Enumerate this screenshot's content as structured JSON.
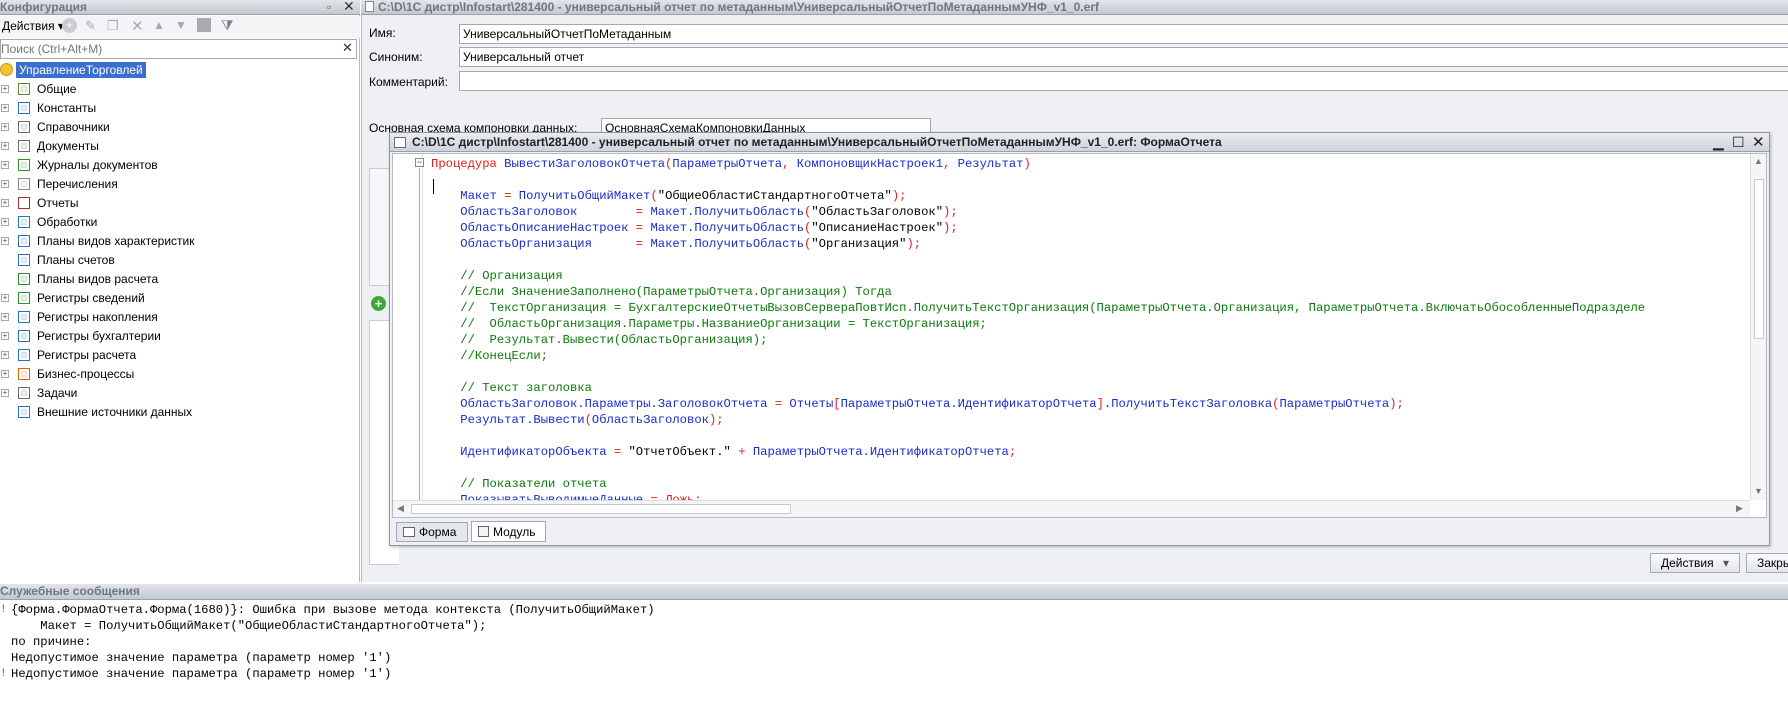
{
  "config_panel": {
    "title": "Конфигурация",
    "actions_label": "Действия",
    "search_placeholder": "Поиск (Ctrl+Alt+M)",
    "root": "УправлениеТорговлей",
    "items": [
      {
        "label": "Общие",
        "icon": "general-icon"
      },
      {
        "label": "Константы",
        "icon": "constants-icon"
      },
      {
        "label": "Справочники",
        "icon": "catalogs-icon"
      },
      {
        "label": "Документы",
        "icon": "documents-icon"
      },
      {
        "label": "Журналы документов",
        "icon": "journals-icon"
      },
      {
        "label": "Перечисления",
        "icon": "enums-icon"
      },
      {
        "label": "Отчеты",
        "icon": "reports-icon"
      },
      {
        "label": "Обработки",
        "icon": "dataprocessors-icon"
      },
      {
        "label": "Планы видов характеристик",
        "icon": "chart-char-icon"
      },
      {
        "label": "Планы счетов",
        "icon": "chart-accounts-icon"
      },
      {
        "label": "Планы видов расчета",
        "icon": "chart-calc-icon"
      },
      {
        "label": "Регистры сведений",
        "icon": "info-registers-icon"
      },
      {
        "label": "Регистры накопления",
        "icon": "accum-registers-icon"
      },
      {
        "label": "Регистры бухгалтерии",
        "icon": "acc-registers-icon"
      },
      {
        "label": "Регистры расчета",
        "icon": "calc-registers-icon"
      },
      {
        "label": "Бизнес-процессы",
        "icon": "bp-icon"
      },
      {
        "label": "Задачи",
        "icon": "tasks-icon"
      },
      {
        "label": "Внешние источники данных",
        "icon": "ext-sources-icon"
      }
    ]
  },
  "report_window": {
    "title": "C:\\D\\1C дистр\\Infostart\\281400 - универсальный отчет по метаданным\\УниверсальныйОтчетПоМетаданнымУНФ_v1_0.erf",
    "name_label": "Имя:",
    "name_value": "УниверсальныйОтчетПоМетаданным",
    "synonym_label": "Синоним:",
    "synonym_value": "Универсальный отчет",
    "comment_label": "Комментарий:",
    "comment_value": "",
    "schema_label": "Основная схема компоновки данных:",
    "schema_value": "ОсновнаяСхемаКомпоновкиДанных",
    "actions_button": "Действия",
    "close_button": "Закрыть"
  },
  "module_window": {
    "title": "C:\\D\\1C дистр\\Infostart\\281400 - универсальный отчет по метаданным\\УниверсальныйОтчетПоМетаданнымУНФ_v1_0.erf: ФормаОтчета",
    "tabs": [
      "Форма",
      "Модуль"
    ],
    "code_lines": [
      [
        [
          "kw",
          "Процедура "
        ],
        [
          "id",
          "ВывестиЗаголовокОтчета"
        ],
        [
          "op",
          "("
        ],
        [
          "id",
          "ПараметрыОтчета"
        ],
        [
          "op",
          ", "
        ],
        [
          "id",
          "КомпоновщикНастроек1"
        ],
        [
          "op",
          ", "
        ],
        [
          "id",
          "Результат"
        ],
        [
          "op",
          ")"
        ]
      ],
      [],
      [
        [
          "id",
          "    Макет "
        ],
        [
          "op",
          "= "
        ],
        [
          "id",
          "ПолучитьОбщийМакет"
        ],
        [
          "op",
          "("
        ],
        [
          "st",
          "\"ОбщиеОбластиСтандартногоОтчета\""
        ],
        [
          "op",
          ");"
        ]
      ],
      [
        [
          "id",
          "    ОбластьЗаголовок        "
        ],
        [
          "op",
          "= "
        ],
        [
          "id",
          "Макет.ПолучитьОбласть"
        ],
        [
          "op",
          "("
        ],
        [
          "st",
          "\"ОбластьЗаголовок\""
        ],
        [
          "op",
          ");"
        ]
      ],
      [
        [
          "id",
          "    ОбластьОписаниеНастроек "
        ],
        [
          "op",
          "= "
        ],
        [
          "id",
          "Макет.ПолучитьОбласть"
        ],
        [
          "op",
          "("
        ],
        [
          "st",
          "\"ОписаниеНастроек\""
        ],
        [
          "op",
          ");"
        ]
      ],
      [
        [
          "id",
          "    ОбластьОрганизация      "
        ],
        [
          "op",
          "= "
        ],
        [
          "id",
          "Макет.ПолучитьОбласть"
        ],
        [
          "op",
          "("
        ],
        [
          "st",
          "\"Организация\""
        ],
        [
          "op",
          ");"
        ]
      ],
      [],
      [
        [
          "cm",
          "    // Организация"
        ]
      ],
      [
        [
          "cm",
          "    //Если ЗначениеЗаполнено(ПараметрыОтчета.Организация) Тогда"
        ]
      ],
      [
        [
          "cm",
          "    //  ТекстОрганизация = БухгалтерскиеОтчетыВызовСервераПовтИсп.ПолучитьТекстОрганизация(ПараметрыОтчета.Организация, ПараметрыОтчета.ВключатьОбособленныеПодразделе"
        ]
      ],
      [
        [
          "cm",
          "    //  ОбластьОрганизация.Параметры.НазваниеОрганизации = ТекстОрганизация;"
        ]
      ],
      [
        [
          "cm",
          "    //  Результат.Вывести(ОбластьОрганизация);"
        ]
      ],
      [
        [
          "cm",
          "    //КонецЕсли;"
        ]
      ],
      [],
      [
        [
          "cm",
          "    // Текст заголовка"
        ]
      ],
      [
        [
          "id",
          "    ОбластьЗаголовок.Параметры.ЗаголовокОтчета "
        ],
        [
          "op",
          "= "
        ],
        [
          "id",
          "Отчеты"
        ],
        [
          "op",
          "["
        ],
        [
          "id",
          "ПараметрыОтчета.ИдентификаторОтчета"
        ],
        [
          "op",
          "]"
        ],
        [
          "id",
          ".ПолучитьТекстЗаголовка"
        ],
        [
          "op",
          "("
        ],
        [
          "id",
          "ПараметрыОтчета"
        ],
        [
          "op",
          ");"
        ]
      ],
      [
        [
          "id",
          "    Результат.Вывести"
        ],
        [
          "op",
          "("
        ],
        [
          "id",
          "ОбластьЗаголовок"
        ],
        [
          "op",
          ");"
        ]
      ],
      [],
      [
        [
          "id",
          "    ИдентификаторОбъекта "
        ],
        [
          "op",
          "= "
        ],
        [
          "st",
          "\"ОтчетОбъект.\""
        ],
        [
          "op",
          " + "
        ],
        [
          "id",
          "ПараметрыОтчета.ИдентификаторОтчета"
        ],
        [
          "op",
          ";"
        ]
      ],
      [],
      [
        [
          "cm",
          "    // Показатели отчета"
        ]
      ],
      [
        [
          "id",
          "    ПоказыватьВыводимыеДанные "
        ],
        [
          "op",
          "= "
        ],
        [
          "kw",
          "Ложь"
        ],
        [
          "op",
          ";"
        ]
      ]
    ]
  },
  "messages_panel": {
    "title": "Служебные сообщения",
    "lines": [
      {
        "marker": "err",
        "text": "{Форма.ФормаОтчета.Форма(1680)}: Ошибка при вызове метода контекста (ПолучитьОбщийМакет)"
      },
      {
        "marker": "",
        "text": "    Макет = ПолучитьОбщийМакет(\"ОбщиеОбластиСтандартногоОтчета\");"
      },
      {
        "marker": "",
        "text": "по причине:"
      },
      {
        "marker": "",
        "text": "Недопустимое значение параметра (параметр номер '1')"
      },
      {
        "marker": "err",
        "text": "Недопустимое значение параметра (параметр номер '1')"
      }
    ]
  },
  "colors": {
    "keyword": "#e31c1c",
    "identifier": "#1a2bcc",
    "comment": "#0b7a0b",
    "selection": "#3a6fd0"
  }
}
